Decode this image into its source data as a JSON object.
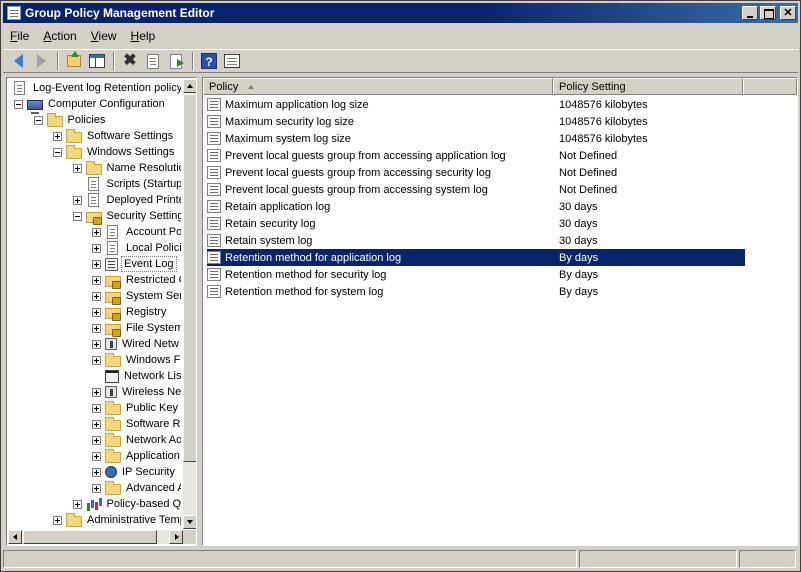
{
  "window": {
    "title": "Group Policy Management Editor",
    "buttons": {
      "minimize": "",
      "maximize": "",
      "close": "✕"
    }
  },
  "menubar": {
    "items": [
      {
        "label": "File",
        "underline": "F",
        "rest": "ile"
      },
      {
        "label": "Action",
        "underline": "A",
        "rest": "ction"
      },
      {
        "label": "View",
        "underline": "V",
        "rest": "iew"
      },
      {
        "label": "Help",
        "underline": "H",
        "rest": "elp"
      }
    ]
  },
  "toolbar": {
    "buttons": [
      "back-icon",
      "forward-icon",
      "up-folder-icon",
      "show-hide-tree-icon",
      "delete-icon",
      "properties-doc-icon",
      "export-list-icon",
      "help-icon",
      "show-hide-action-pane-icon"
    ]
  },
  "tree": {
    "nodes": [
      {
        "label": "Log-Event log Retention policy_",
        "level": 0,
        "expander": "none",
        "icon": "doc"
      },
      {
        "label": "Computer Configuration",
        "level": 0,
        "expander": "minus",
        "icon": "computer"
      },
      {
        "label": "Policies",
        "level": 1,
        "expander": "minus",
        "icon": "folder"
      },
      {
        "label": "Software Settings",
        "level": 2,
        "expander": "plus",
        "icon": "folder"
      },
      {
        "label": "Windows Settings",
        "level": 2,
        "expander": "minus",
        "icon": "folder"
      },
      {
        "label": "Name Resolutio",
        "level": 3,
        "expander": "plus",
        "icon": "folder"
      },
      {
        "label": "Scripts (Startup",
        "level": 3,
        "expander": "none",
        "icon": "doc"
      },
      {
        "label": "Deployed Printe",
        "level": 3,
        "expander": "plus",
        "icon": "doc"
      },
      {
        "label": "Security Setting",
        "level": 3,
        "expander": "minus",
        "icon": "lockfolder"
      },
      {
        "label": "Account Pol",
        "level": 4,
        "expander": "plus",
        "icon": "doc"
      },
      {
        "label": "Local Policie",
        "level": 4,
        "expander": "plus",
        "icon": "doc"
      },
      {
        "label": "Event Log",
        "level": 4,
        "expander": "plus",
        "icon": "log",
        "selected": true
      },
      {
        "label": "Restricted G",
        "level": 4,
        "expander": "plus",
        "icon": "lockfolder"
      },
      {
        "label": "System Serv",
        "level": 4,
        "expander": "plus",
        "icon": "lockfolder"
      },
      {
        "label": "Registry",
        "level": 4,
        "expander": "plus",
        "icon": "lockfolder"
      },
      {
        "label": "File System",
        "level": 4,
        "expander": "plus",
        "icon": "lockfolder"
      },
      {
        "label": "Wired Netw",
        "level": 4,
        "expander": "plus",
        "icon": "wired"
      },
      {
        "label": "Windows Fir",
        "level": 4,
        "expander": "plus",
        "icon": "folder"
      },
      {
        "label": "Network Lis",
        "level": 4,
        "expander": "none",
        "icon": "black"
      },
      {
        "label": "Wireless Ne",
        "level": 4,
        "expander": "plus",
        "icon": "wired"
      },
      {
        "label": "Public Key P",
        "level": 4,
        "expander": "plus",
        "icon": "folder"
      },
      {
        "label": "Software Re",
        "level": 4,
        "expander": "plus",
        "icon": "folder"
      },
      {
        "label": "Network Ac",
        "level": 4,
        "expander": "plus",
        "icon": "folder"
      },
      {
        "label": "Application",
        "level": 4,
        "expander": "plus",
        "icon": "folder"
      },
      {
        "label": "IP Security",
        "level": 4,
        "expander": "plus",
        "icon": "ip"
      },
      {
        "label": "Advanced A",
        "level": 4,
        "expander": "plus",
        "icon": "folder"
      },
      {
        "label": "Policy-based Qo",
        "level": 3,
        "expander": "plus",
        "icon": "chart"
      },
      {
        "label": "Administrative Temp",
        "level": 2,
        "expander": "plus",
        "icon": "folder"
      }
    ]
  },
  "list": {
    "columns": {
      "policy": "Policy",
      "setting": "Policy Setting"
    },
    "rows": [
      {
        "policy": "Maximum application log size",
        "setting": "1048576 kilobytes"
      },
      {
        "policy": "Maximum security log size",
        "setting": "1048576 kilobytes"
      },
      {
        "policy": "Maximum system log size",
        "setting": "1048576 kilobytes"
      },
      {
        "policy": "Prevent local guests group from accessing application log",
        "setting": "Not Defined"
      },
      {
        "policy": "Prevent local guests group from accessing security log",
        "setting": "Not Defined"
      },
      {
        "policy": "Prevent local guests group from accessing system log",
        "setting": "Not Defined"
      },
      {
        "policy": "Retain application log",
        "setting": "30 days"
      },
      {
        "policy": "Retain security log",
        "setting": "30 days"
      },
      {
        "policy": "Retain system log",
        "setting": "30 days"
      },
      {
        "policy": "Retention method for application log",
        "setting": "By days",
        "selected": true
      },
      {
        "policy": "Retention method for security log",
        "setting": "By days"
      },
      {
        "policy": "Retention method for system log",
        "setting": "By days"
      }
    ]
  },
  "colors": {
    "titlebar": "#0a246a",
    "selection": "#0a246a",
    "chrome": "#d4d0c8"
  }
}
